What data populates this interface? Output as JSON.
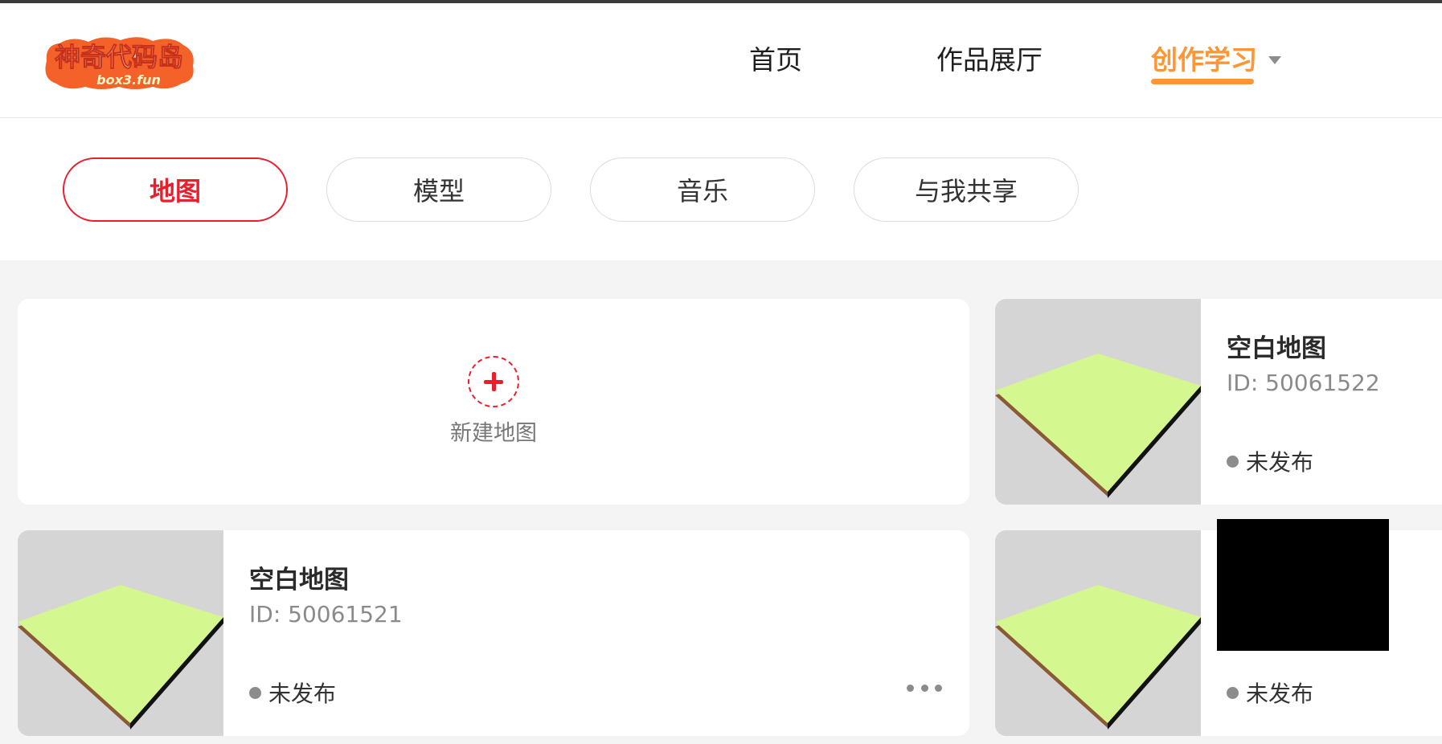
{
  "header": {
    "logo_text": "神奇代码岛",
    "logo_subtext": "box3.fun",
    "nav": {
      "home": "首页",
      "gallery": "作品展厅",
      "learn": "创作学习"
    }
  },
  "tabs": [
    {
      "label": "地图",
      "active": true
    },
    {
      "label": "模型",
      "active": false
    },
    {
      "label": "音乐",
      "active": false
    },
    {
      "label": "与我共享",
      "active": false
    }
  ],
  "new_map": {
    "label": "新建地图"
  },
  "maps": [
    {
      "title": "空白地图",
      "id": "ID: 50061522",
      "status": "未发布"
    },
    {
      "title": "空白地图",
      "id": "ID: 50061521",
      "status": "未发布"
    },
    {
      "title": "",
      "id": "",
      "status": "未发布"
    }
  ],
  "colors": {
    "accent_orange": "#ff9533",
    "accent_red": "#e8202e",
    "map_top": "#d5f78f",
    "map_side": "#8a5a34"
  }
}
